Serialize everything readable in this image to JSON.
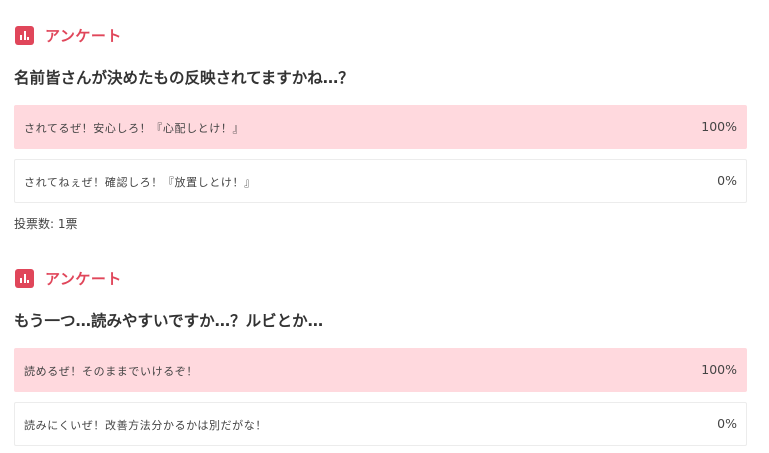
{
  "polls": [
    {
      "label": "アンケート",
      "question": "名前皆さんが決めたもの反映されてますかね…？",
      "options": [
        {
          "text": "されてるぜ！安心しろ！『心配しとけ！』",
          "percent": "100%"
        },
        {
          "text": "されてねぇぜ！確認しろ！『放置しとけ！』",
          "percent": "0%"
        }
      ],
      "vote_count": "投票数: 1票"
    },
    {
      "label": "アンケート",
      "question": "もう一つ…読みやすいですか…？ルビとか…",
      "options": [
        {
          "text": "読めるぜ！そのままでいけるぞ！",
          "percent": "100%"
        },
        {
          "text": "読みにくいぜ！改善方法分かるかは別だがな！",
          "percent": "0%"
        }
      ]
    }
  ],
  "colors": {
    "accent": "#e0465a",
    "winner_fill": "#ffd9de",
    "text": "#333333"
  },
  "icons": {
    "poll_icon": "bar-chart-icon"
  }
}
